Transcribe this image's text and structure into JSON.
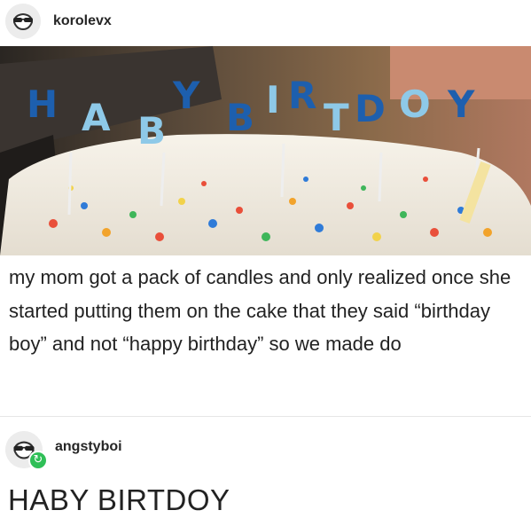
{
  "post": {
    "author": "korolevx",
    "author_avatar_icon": "sunglasses-avatar-icon",
    "photo_description_icon": "birthday-cake-photo",
    "caption": "my mom got a pack of candles and only realized once she started putting them on the cake that they said “birthday boy” and not “happy birthday” so we made do"
  },
  "reblog": {
    "author": "angstyboi",
    "author_avatar_icon": "sunglasses-avatar-icon",
    "badge_icon": "reblog-icon",
    "badge_color": "#2fbf57",
    "text": "HABY BIRTDOY"
  }
}
